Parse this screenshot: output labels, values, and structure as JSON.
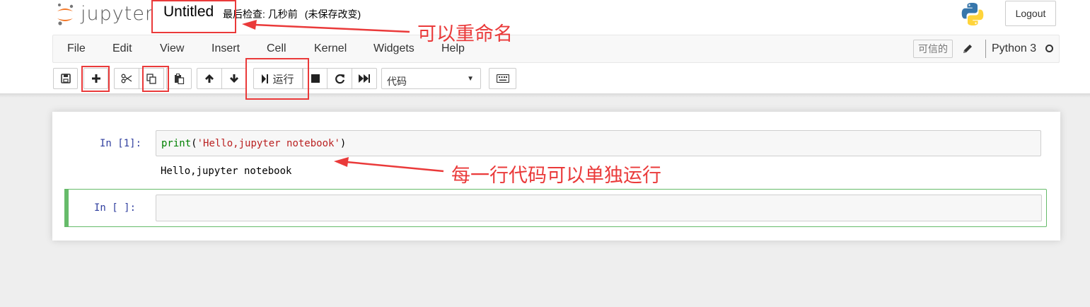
{
  "header": {
    "logo_text": "jupyter",
    "notebook_name": "Untitled",
    "checkpoint": "最后检查: 几秒前",
    "autosave_status": "(未保存改变)",
    "logout_label": "Logout"
  },
  "menubar": {
    "items": [
      "File",
      "Edit",
      "View",
      "Insert",
      "Cell",
      "Kernel",
      "Widgets",
      "Help"
    ],
    "trusted_label": "可信的",
    "kernel_name": "Python 3"
  },
  "toolbar": {
    "run_label": "运行",
    "cell_type": "代码",
    "buttons": [
      "save-icon",
      "plus-icon",
      "cut-icon",
      "copy-icon",
      "paste-icon",
      "arrow-up-icon",
      "arrow-down-icon",
      "run-icon",
      "stop-icon",
      "restart-icon",
      "fast-forward-icon",
      "keyboard-icon"
    ]
  },
  "cells": [
    {
      "prompt": "In  [1]:",
      "code_func": "print",
      "code_open": "(",
      "code_string": "'Hello,jupyter notebook'",
      "code_close": ")",
      "output": "Hello,jupyter notebook"
    },
    {
      "prompt": "In  [ ]:",
      "code": ""
    }
  ],
  "annotations": {
    "rename": "可以重命名",
    "run_line": "每一行代码可以单独运行"
  },
  "colors": {
    "annotation_red": "#ea3a3a",
    "selected_cell_green": "#66bb6a",
    "prompt_blue": "#303f9f",
    "python_blue": "#3776ab",
    "python_yellow": "#ffd43b",
    "jupyter_orange": "#f37726"
  }
}
